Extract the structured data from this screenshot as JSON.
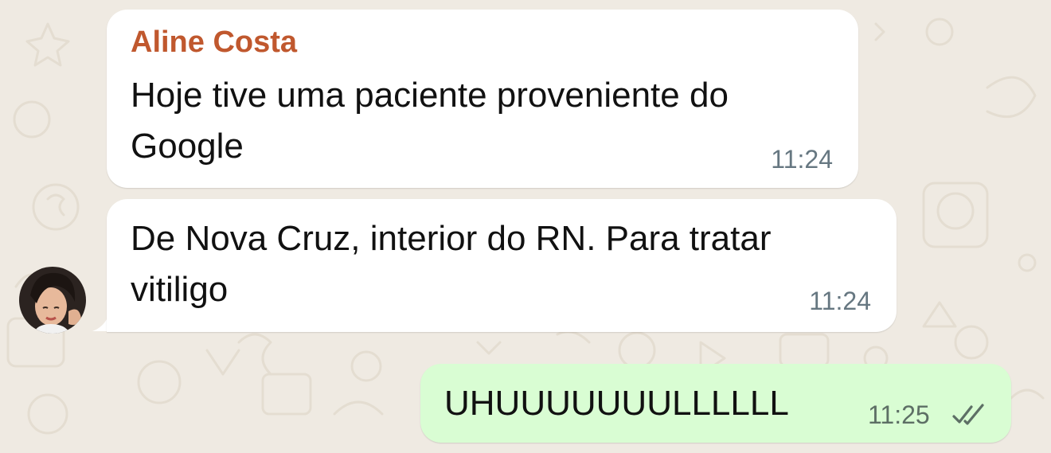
{
  "chat": {
    "messages": [
      {
        "direction": "incoming",
        "sender": "Aline Costa",
        "text_lines": [
          "Hoje tive uma paciente proveniente do",
          "Google"
        ],
        "time": "11:24"
      },
      {
        "direction": "incoming",
        "text_lines": [
          "De Nova Cruz, interior do RN. Para tratar",
          "vitiligo"
        ],
        "time": "11:24"
      },
      {
        "direction": "outgoing",
        "text_lines": [
          "UHUUUUUUULLLLLL"
        ],
        "time": "11:25",
        "status_icon": "double-check-read-icon"
      }
    ]
  },
  "colors": {
    "wallpaper": "#efeae2",
    "incoming_bubble": "#ffffff",
    "outgoing_bubble": "#d9fdd3",
    "sender_name": "#c0582e",
    "timestamp": "#667781"
  },
  "avatar": {
    "icon": "contact-avatar-photo"
  }
}
